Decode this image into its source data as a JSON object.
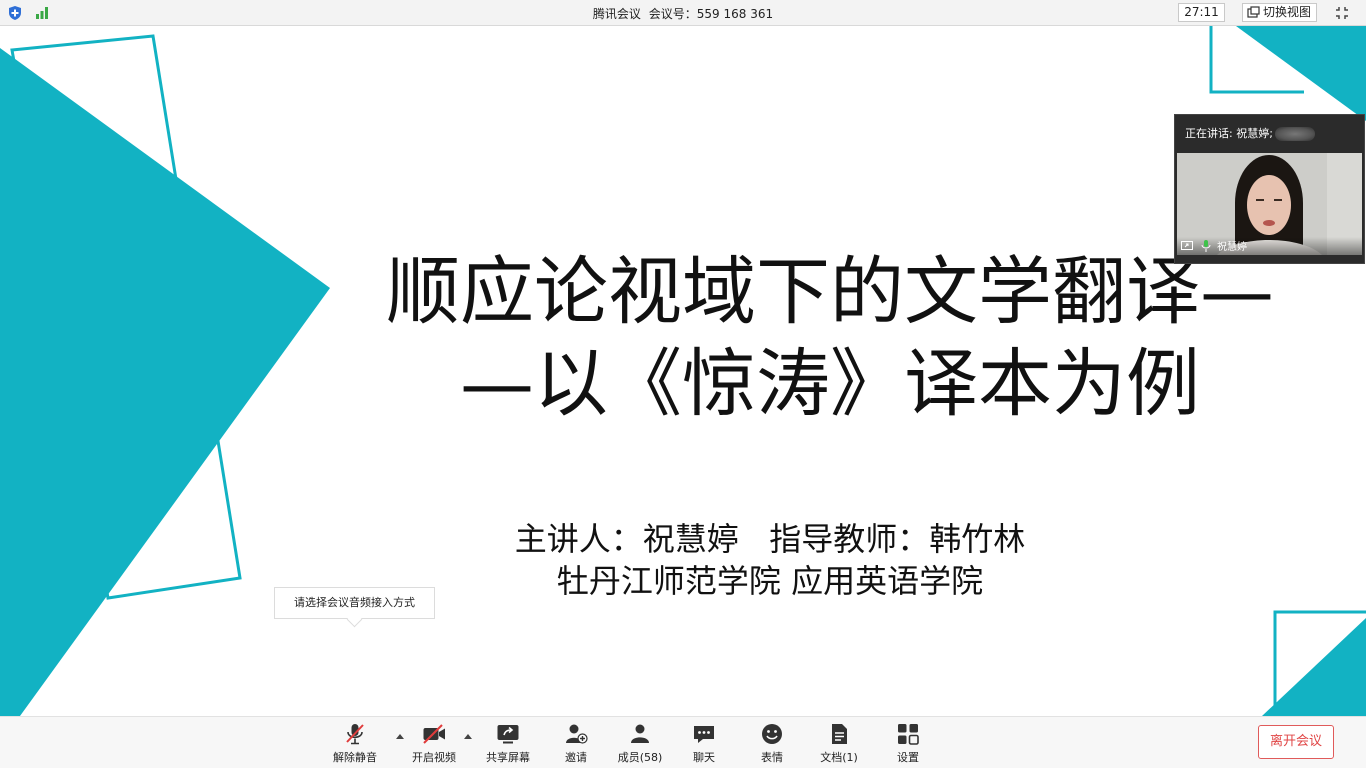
{
  "topbar": {
    "title_app": "腾讯会议",
    "title_meeting": "会议号：559 168 361",
    "timer": "27:11",
    "switch_view_label": "切换视图",
    "icons": [
      "shield-icon",
      "signal-icon",
      "fullscreen-icon"
    ]
  },
  "slide": {
    "title_line1": "顺应论视域下的文学翻译—",
    "title_line2": "—以《惊涛》译本为例",
    "subtitle_line1": "主讲人：祝慧婷   指导教师：韩竹林",
    "subtitle_line2": "牡丹江师范学院 应用英语学院",
    "accent_color": "#12b2c3"
  },
  "tooltip": {
    "text": "请选择会议音频接入方式"
  },
  "speaker_panel": {
    "speaking_label": "正在讲话: 祝慧婷;",
    "participant_name": "祝慧婷"
  },
  "toolbar": {
    "unmute": "解除静音",
    "start_video": "开启视频",
    "share_screen": "共享屏幕",
    "invite": "邀请",
    "members": "成员(58)",
    "chat": "聊天",
    "reactions": "表情",
    "documents": "文档(1)",
    "settings": "设置",
    "leave": "离开会议",
    "leave_color": "#e04545"
  }
}
